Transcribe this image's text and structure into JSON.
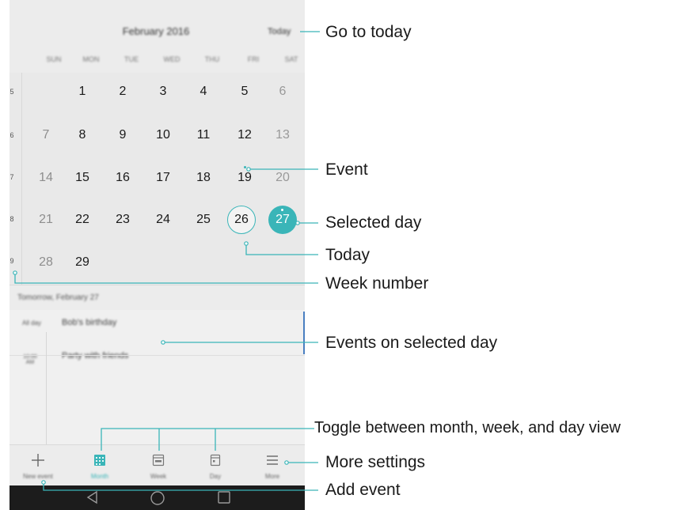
{
  "header": {
    "month_title": "February 2016",
    "today_button": "Today"
  },
  "weekday_labels": [
    "SUN",
    "MON",
    "TUE",
    "WED",
    "THU",
    "FRI",
    "SAT"
  ],
  "week_numbers": [
    "5",
    "6",
    "7",
    "8",
    "9"
  ],
  "weeks": [
    [
      "",
      "1",
      "2",
      "3",
      "4",
      "5",
      "6"
    ],
    [
      "7",
      "8",
      "9",
      "10",
      "11",
      "12",
      "13"
    ],
    [
      "14",
      "15",
      "16",
      "17",
      "18",
      "19",
      "20"
    ],
    [
      "21",
      "22",
      "23",
      "24",
      "25",
      "26",
      "27"
    ],
    [
      "28",
      "29",
      "",
      "",
      "",
      "",
      ""
    ]
  ],
  "events_panel": {
    "date_header": "Tomorrow, February 27",
    "all_day_label": "All day",
    "all_day_event": "Bob's birthday",
    "time_label": "10:00 AM",
    "timed_event": "Party with friends"
  },
  "bottom_nav": [
    {
      "label": "New event",
      "icon": "plus-icon"
    },
    {
      "label": "Month",
      "icon": "month-view-icon"
    },
    {
      "label": "Week",
      "icon": "week-view-icon"
    },
    {
      "label": "Day",
      "icon": "day-view-icon"
    },
    {
      "label": "More",
      "icon": "menu-icon"
    }
  ],
  "system_nav": {
    "back": "back-icon",
    "home": "home-icon",
    "recents": "recents-icon"
  },
  "callouts": {
    "go_to_today": "Go to today",
    "event": "Event",
    "selected_day": "Selected day",
    "today": "Today",
    "week_number": "Week number",
    "events_on_selected_day": "Events on selected day",
    "toggle_views": "Toggle between month, week, and day view",
    "more_settings": "More settings",
    "add_event": "Add event"
  },
  "colors": {
    "accent": "#3ab5b8",
    "event_bar": "#4a7fc1",
    "background": "#ececec"
  }
}
